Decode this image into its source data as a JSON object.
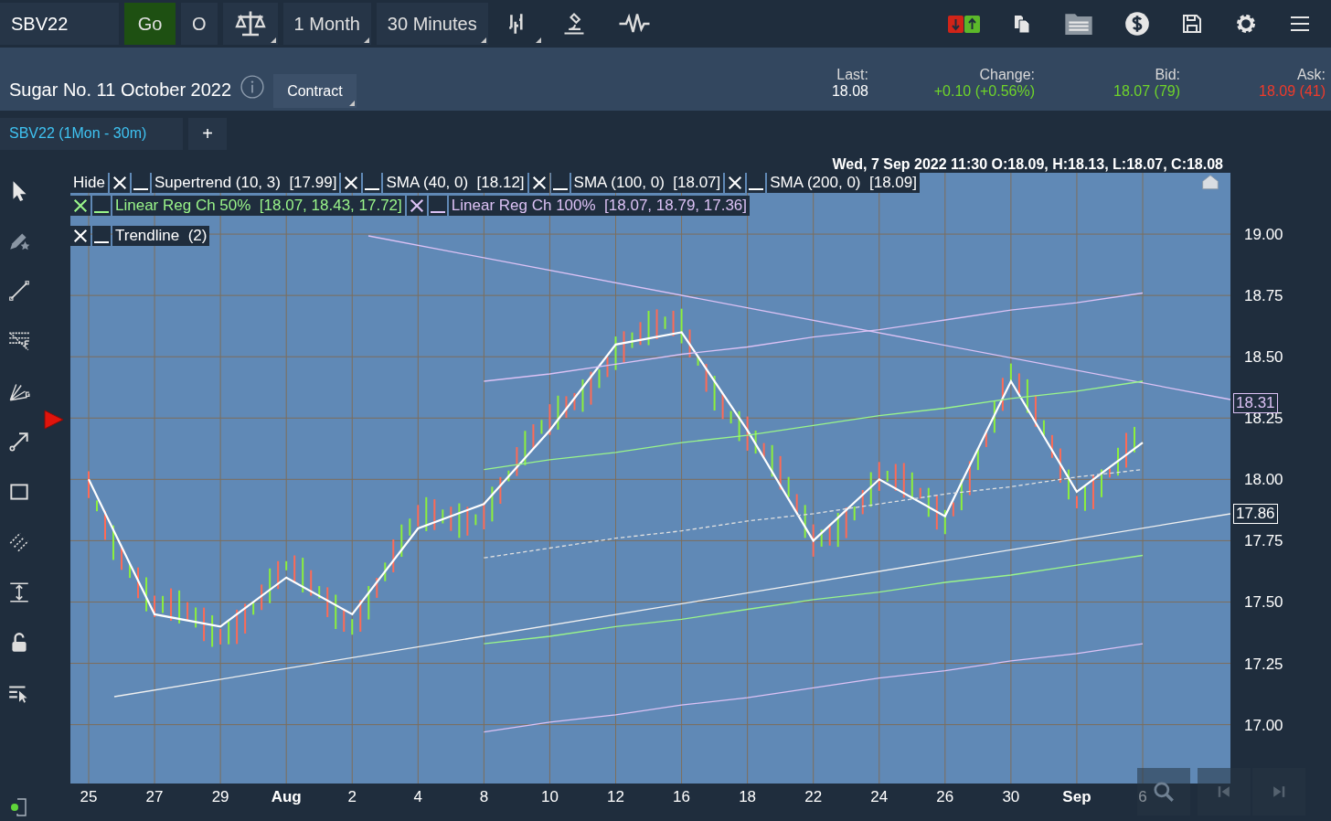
{
  "toolbar": {
    "symbol": "SBV22",
    "go": "Go",
    "o_button": "O",
    "range": "1 Month",
    "interval": "30 Minutes"
  },
  "header": {
    "title": "Sugar No. 11 October 2022",
    "contract_button": "Contract",
    "quotes": [
      {
        "label": "Last:",
        "value": "18.08",
        "color": "#ffffff"
      },
      {
        "label": "Change:",
        "value": "+0.10 (+0.56%)",
        "color": "#6fd42a"
      },
      {
        "label": "Bid:",
        "value": "18.07 (79)",
        "color": "#6fd42a"
      },
      {
        "label": "Ask:",
        "value": "18.09 (41)",
        "color": "#f03a2a"
      }
    ]
  },
  "chart_tabs": [
    {
      "label": "SBV22 (1Mon - 30m)",
      "selected": true
    }
  ],
  "add_tab": "+",
  "bar_info": "Wed, 7 Sep 2022 11:30  O:18.09, H:18.13, L:18.07, C:18.08",
  "legend": {
    "hide": "Hide",
    "rows": [
      [
        {
          "label": "Supertrend (10, 3)",
          "value": "[17.99]",
          "color": "#ffffff"
        },
        {
          "label": "SMA (40, 0)",
          "value": "[18.12]",
          "color": "#ffffff"
        },
        {
          "label": "SMA (100, 0)",
          "value": "[18.07]",
          "color": "#ffffff"
        },
        {
          "label": "SMA (200, 0)",
          "value": "[18.09]",
          "color": "#ffffff"
        }
      ],
      [
        {
          "label": "Linear Reg Ch 50%",
          "value": "[18.07, 18.43, 17.72]",
          "color": "#9af58a"
        },
        {
          "label": "Linear Reg Ch 100%",
          "value": "[18.07, 18.79, 17.36]",
          "color": "#dcc2f5"
        }
      ],
      [
        {
          "label": "Trendline",
          "value": "(2)",
          "color": "#ffffff"
        }
      ]
    ]
  },
  "price_tags": [
    {
      "value": "18.31",
      "color": "#dcc2f5"
    },
    {
      "value": "17.86",
      "color": "#ffffff"
    }
  ],
  "chart_data": {
    "type": "line",
    "grid": true,
    "categories": [
      {
        "label": "25",
        "kind": "day"
      },
      {
        "label": "27",
        "kind": "day"
      },
      {
        "label": "29",
        "kind": "day"
      },
      {
        "label": "Aug",
        "kind": "month"
      },
      {
        "label": "2",
        "kind": "day"
      },
      {
        "label": "4",
        "kind": "day"
      },
      {
        "label": "8",
        "kind": "day"
      },
      {
        "label": "10",
        "kind": "day"
      },
      {
        "label": "12",
        "kind": "day"
      },
      {
        "label": "16",
        "kind": "day"
      },
      {
        "label": "18",
        "kind": "day"
      },
      {
        "label": "22",
        "kind": "day"
      },
      {
        "label": "24",
        "kind": "day"
      },
      {
        "label": "26",
        "kind": "day"
      },
      {
        "label": "30",
        "kind": "day"
      },
      {
        "label": "Sep",
        "kind": "month"
      },
      {
        "label": "6",
        "kind": "day"
      }
    ],
    "ylim": [
      16.76,
      19.25
    ],
    "yticks": [
      {
        "value": 17,
        "label": "17.00"
      },
      {
        "value": 17.25,
        "label": "17.25"
      },
      {
        "value": 17.5,
        "label": "17.50"
      },
      {
        "value": 17.75,
        "label": "17.75"
      },
      {
        "value": 18,
        "label": "18.00"
      },
      {
        "value": 18.25,
        "label": "18.25"
      },
      {
        "value": 18.5,
        "label": "18.50"
      },
      {
        "value": 18.75,
        "label": "18.75"
      },
      {
        "value": 19,
        "label": "19.00"
      }
    ],
    "series": [
      {
        "color": "#ffffff",
        "line_style": "solid",
        "values": [
          18.0,
          17.45,
          17.4,
          17.6,
          17.45,
          17.8,
          17.9,
          18.2,
          18.55,
          18.6,
          18.2,
          17.75,
          18.0,
          17.85,
          18.4,
          17.95,
          18.15
        ]
      },
      {
        "color": "#9af58a",
        "line_style": "solid",
        "values": [
          null,
          null,
          null,
          null,
          null,
          null,
          18.04,
          18.08,
          18.11,
          18.15,
          18.18,
          18.22,
          18.26,
          18.29,
          18.33,
          18.36,
          18.4
        ]
      },
      {
        "color": "#e0e0e0",
        "line_style": "dashed",
        "values": [
          null,
          null,
          null,
          null,
          null,
          null,
          17.68,
          17.72,
          17.76,
          17.79,
          17.83,
          17.86,
          17.9,
          17.94,
          17.97,
          18.01,
          18.04
        ]
      },
      {
        "color": "#9af58a",
        "line_style": "solid",
        "values": [
          null,
          null,
          null,
          null,
          null,
          null,
          17.33,
          17.36,
          17.4,
          17.43,
          17.47,
          17.51,
          17.54,
          17.58,
          17.61,
          17.65,
          17.69
        ]
      },
      {
        "color": "#dcc2f5",
        "line_style": "solid",
        "values": [
          null,
          null,
          null,
          null,
          null,
          null,
          18.4,
          18.43,
          18.47,
          18.51,
          18.54,
          18.58,
          18.61,
          18.65,
          18.69,
          18.72,
          18.76
        ]
      },
      {
        "color": "#dcc2f5",
        "line_style": "solid",
        "values": [
          null,
          null,
          null,
          null,
          null,
          null,
          16.97,
          17.01,
          17.04,
          17.08,
          17.11,
          17.15,
          17.19,
          17.22,
          17.26,
          17.29,
          17.33
        ]
      }
    ]
  }
}
